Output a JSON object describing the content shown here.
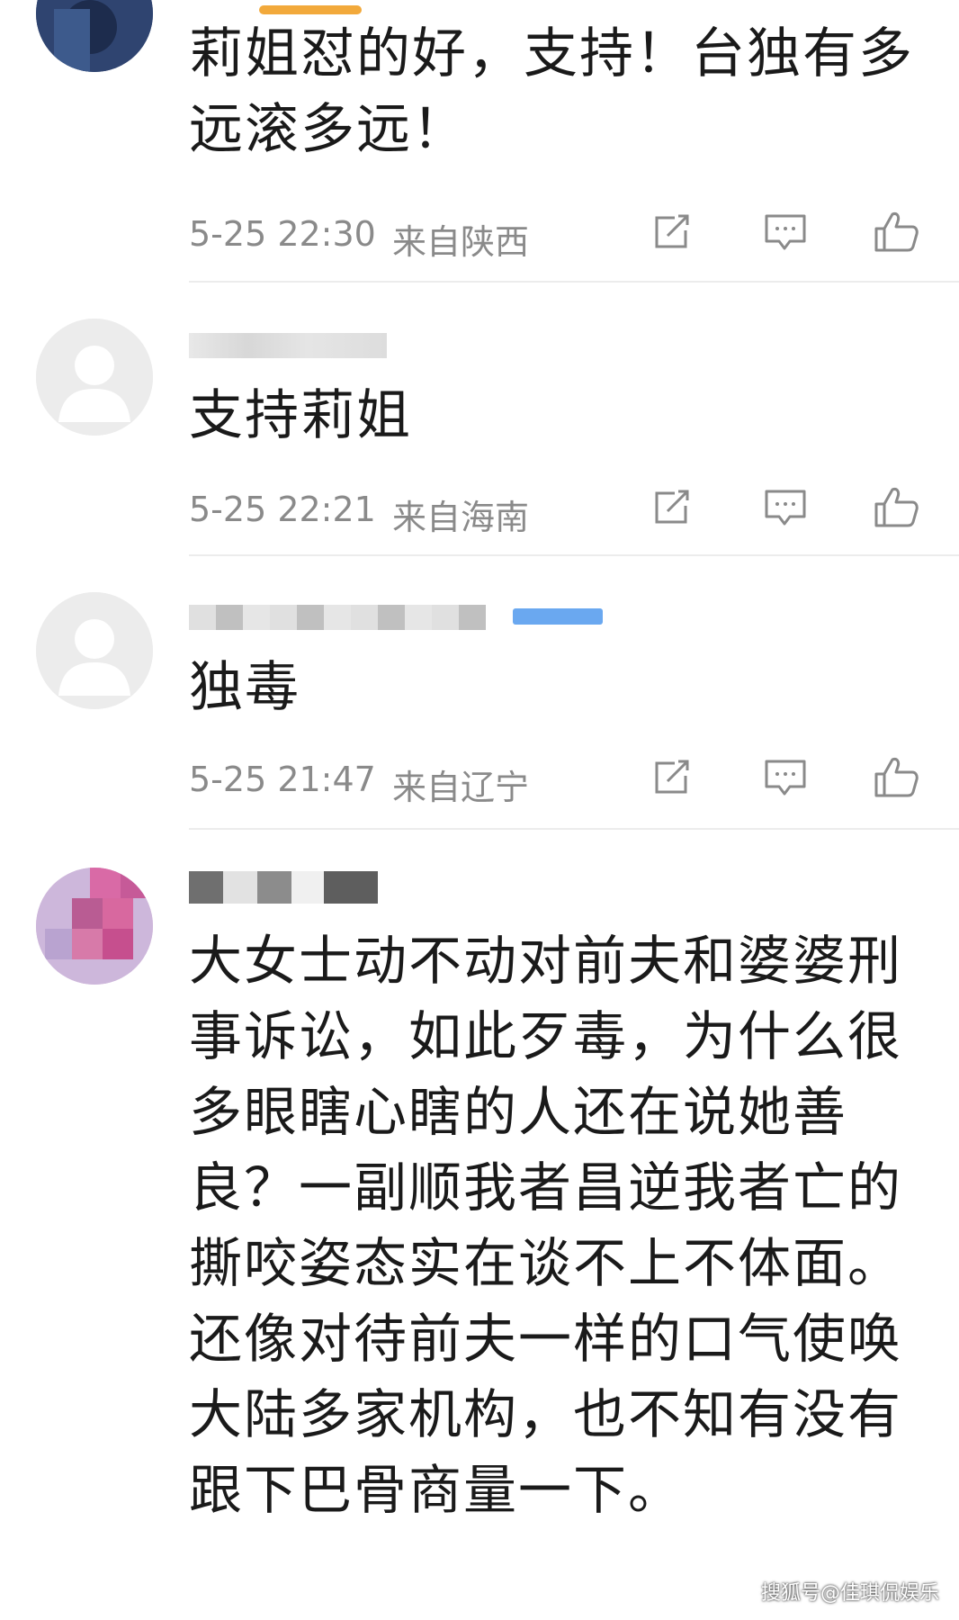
{
  "comments": [
    {
      "username": "",
      "content": "莉姐怼的好，支持！台独有多远滚多远！",
      "time": "5-25 22:30",
      "location": "来自陕西"
    },
    {
      "username": "",
      "content": "支持莉姐",
      "time": "5-25 22:21",
      "location": "来自海南"
    },
    {
      "username": "",
      "content": "独毒",
      "time": "5-25 21:47",
      "location": "来自辽宁"
    },
    {
      "username": "",
      "content": "大女士动不动对前夫和婆婆刑事诉讼，如此歹毒，为什么很多眼瞎心瞎的人还在说她善良？一副顺我者昌逆我者亡的撕咬姿态实在谈不上不体面。还像对待前夫一样的口气使唤大陆多家机构，也不知有没有跟下巴骨商量一下。",
      "time": "",
      "location": ""
    }
  ],
  "icons": {
    "share": "share-icon",
    "reply": "comment-icon",
    "like": "thumbs-up-icon"
  },
  "colors": {
    "meta_text": "#8a8a8a",
    "divider": "#ececec",
    "accent": "#f2a93b",
    "badge_blue": "#6aa8f0"
  },
  "watermark": "搜狐号@佳琪侃娱乐"
}
